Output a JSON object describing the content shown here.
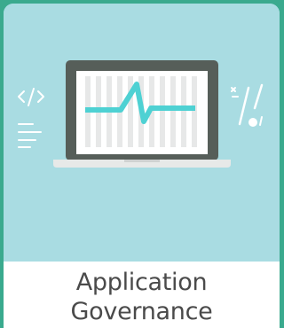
{
  "card": {
    "title_line1": "Application",
    "title_line2": "Governance",
    "illustration_icon": "laptop-heartbeat-icon",
    "code_icon": "code-brackets-icon",
    "accent_color": "#4ed1d3",
    "background_color": "#a9dce2"
  }
}
